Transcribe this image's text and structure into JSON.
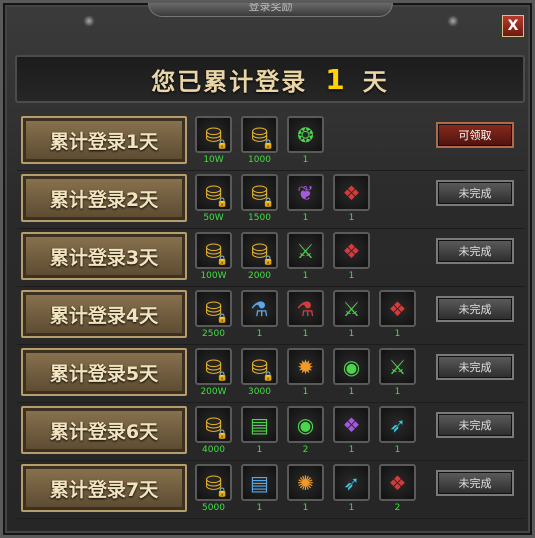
{
  "window": {
    "title": "登录奖励",
    "close_label": "X"
  },
  "header": {
    "prefix": "您已累计登录",
    "days": "1",
    "suffix": "天"
  },
  "rows": [
    {
      "label": "累计登录1天",
      "status": "可领取",
      "status_type": "claim",
      "items": [
        {
          "icon": "gold-ingot-icon",
          "glyph": "⛁",
          "qty": "10W",
          "locked": true,
          "color": "ic-gold"
        },
        {
          "icon": "gold-ingot-icon",
          "glyph": "⛁",
          "qty": "1000",
          "locked": true,
          "color": "ic-gold"
        },
        {
          "icon": "gem-nest-icon",
          "glyph": "❂",
          "qty": "1",
          "locked": false,
          "color": "ic-green"
        }
      ]
    },
    {
      "label": "累计登录2天",
      "status": "未完成",
      "status_type": "pending",
      "items": [
        {
          "icon": "gold-ingot-icon",
          "glyph": "⛁",
          "qty": "50W",
          "locked": true,
          "color": "ic-gold"
        },
        {
          "icon": "gold-ingot-icon",
          "glyph": "⛁",
          "qty": "1500",
          "locked": true,
          "color": "ic-gold"
        },
        {
          "icon": "wings-icon",
          "glyph": "❦",
          "qty": "1",
          "locked": false,
          "color": "ic-purple"
        },
        {
          "icon": "red-gem-icon",
          "glyph": "❖",
          "qty": "1",
          "locked": false,
          "color": "ic-red"
        }
      ]
    },
    {
      "label": "累计登录3天",
      "status": "未完成",
      "status_type": "pending",
      "items": [
        {
          "icon": "gold-ingot-icon",
          "glyph": "⛁",
          "qty": "100W",
          "locked": true,
          "color": "ic-gold"
        },
        {
          "icon": "gold-ingot-icon",
          "glyph": "⛁",
          "qty": "2000",
          "locked": true,
          "color": "ic-gold"
        },
        {
          "icon": "green-sword-icon",
          "glyph": "⚔",
          "qty": "1",
          "locked": false,
          "color": "ic-green"
        },
        {
          "icon": "red-gem-icon",
          "glyph": "❖",
          "qty": "1",
          "locked": false,
          "color": "ic-red"
        }
      ]
    },
    {
      "label": "累计登录4天",
      "status": "未完成",
      "status_type": "pending",
      "items": [
        {
          "icon": "gold-ingot-icon",
          "glyph": "⛁",
          "qty": "2500",
          "locked": true,
          "color": "ic-gold"
        },
        {
          "icon": "blue-potion-icon",
          "glyph": "⚗",
          "qty": "1",
          "locked": false,
          "color": "ic-blue"
        },
        {
          "icon": "red-potion-icon",
          "glyph": "⚗",
          "qty": "1",
          "locked": false,
          "color": "ic-red"
        },
        {
          "icon": "green-sword-icon",
          "glyph": "⚔",
          "qty": "1",
          "locked": false,
          "color": "ic-green"
        },
        {
          "icon": "red-gem-icon",
          "glyph": "❖",
          "qty": "1",
          "locked": false,
          "color": "ic-red"
        }
      ]
    },
    {
      "label": "累计登录5天",
      "status": "未完成",
      "status_type": "pending",
      "items": [
        {
          "icon": "gold-ingot-icon",
          "glyph": "⛁",
          "qty": "200W",
          "locked": true,
          "color": "ic-gold"
        },
        {
          "icon": "gold-ingot-icon",
          "glyph": "⛁",
          "qty": "3000",
          "locked": true,
          "color": "ic-gold"
        },
        {
          "icon": "fire-scroll-icon",
          "glyph": "✹",
          "qty": "1",
          "locked": false,
          "color": "ic-orange"
        },
        {
          "icon": "green-orb-icon",
          "glyph": "◉",
          "qty": "1",
          "locked": false,
          "color": "ic-green"
        },
        {
          "icon": "green-sword-icon",
          "glyph": "⚔",
          "qty": "1",
          "locked": false,
          "color": "ic-green"
        }
      ]
    },
    {
      "label": "累计登录6天",
      "status": "未完成",
      "status_type": "pending",
      "items": [
        {
          "icon": "gold-ingot-icon",
          "glyph": "⛁",
          "qty": "4000",
          "locked": true,
          "color": "ic-gold"
        },
        {
          "icon": "green-ticket-icon",
          "glyph": "▤",
          "qty": "1",
          "locked": false,
          "color": "ic-green"
        },
        {
          "icon": "green-orb-icon",
          "glyph": "◉",
          "qty": "2",
          "locked": false,
          "color": "ic-green"
        },
        {
          "icon": "purple-gem-icon",
          "glyph": "❖",
          "qty": "1",
          "locked": false,
          "color": "ic-purple"
        },
        {
          "icon": "cyan-feather-icon",
          "glyph": "➶",
          "qty": "1",
          "locked": false,
          "color": "ic-cyan"
        }
      ]
    },
    {
      "label": "累计登录7天",
      "status": "未完成",
      "status_type": "pending",
      "items": [
        {
          "icon": "gold-ingot-icon",
          "glyph": "⛁",
          "qty": "5000",
          "locked": true,
          "color": "ic-gold"
        },
        {
          "icon": "blue-ticket-icon",
          "glyph": "▤",
          "qty": "1",
          "locked": false,
          "color": "ic-blue"
        },
        {
          "icon": "fire-orb-icon",
          "glyph": "✺",
          "qty": "1",
          "locked": false,
          "color": "ic-orange"
        },
        {
          "icon": "cyan-feather-icon",
          "glyph": "➶",
          "qty": "1",
          "locked": false,
          "color": "ic-cyan"
        },
        {
          "icon": "red-gem-icon",
          "glyph": "❖",
          "qty": "2",
          "locked": false,
          "color": "ic-red"
        }
      ]
    }
  ]
}
